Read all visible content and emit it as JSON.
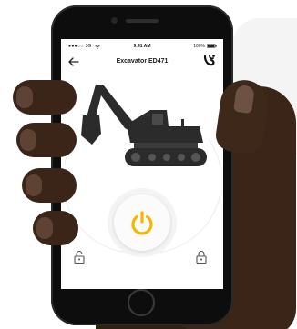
{
  "status_bar": {
    "signal_dots": "●●●○○",
    "carrier": "3G",
    "time": "9:41 AM",
    "battery": "100%"
  },
  "header": {
    "title": "Excavator ED471",
    "back_icon": "arrow-left-icon",
    "brand_icon": "brand-logo-icon"
  },
  "machine": {
    "image": "excavator-silhouette"
  },
  "controls": {
    "power_icon": "power-icon",
    "power_color": "#f5b800",
    "lock_left_icon": "lock-open-icon",
    "lock_right_icon": "lock-closed-icon"
  }
}
